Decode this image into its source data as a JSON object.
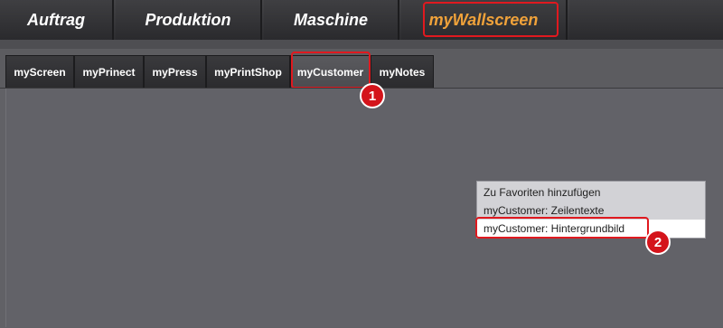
{
  "main_tabs": [
    {
      "label": "Auftrag"
    },
    {
      "label": "Produktion"
    },
    {
      "label": "Maschine"
    },
    {
      "label": "myWallscreen",
      "active": true
    }
  ],
  "sub_tabs": [
    {
      "label": "myScreen"
    },
    {
      "label": "myPrinect"
    },
    {
      "label": "myPress"
    },
    {
      "label": "myPrintShop"
    },
    {
      "label": "myCustomer",
      "active": true
    },
    {
      "label": "myNotes"
    }
  ],
  "callouts": [
    "1",
    "2"
  ],
  "context_menu": {
    "items": [
      {
        "label": "Zu Favoriten hinzufügen"
      },
      {
        "label": "myCustomer: Zeilentexte"
      },
      {
        "label": "myCustomer: Hintergrundbild",
        "selected": true
      }
    ]
  },
  "colors": {
    "active_tab_text": "#f0a23a",
    "highlight": "#e0191f",
    "badge": "#d4141b"
  }
}
